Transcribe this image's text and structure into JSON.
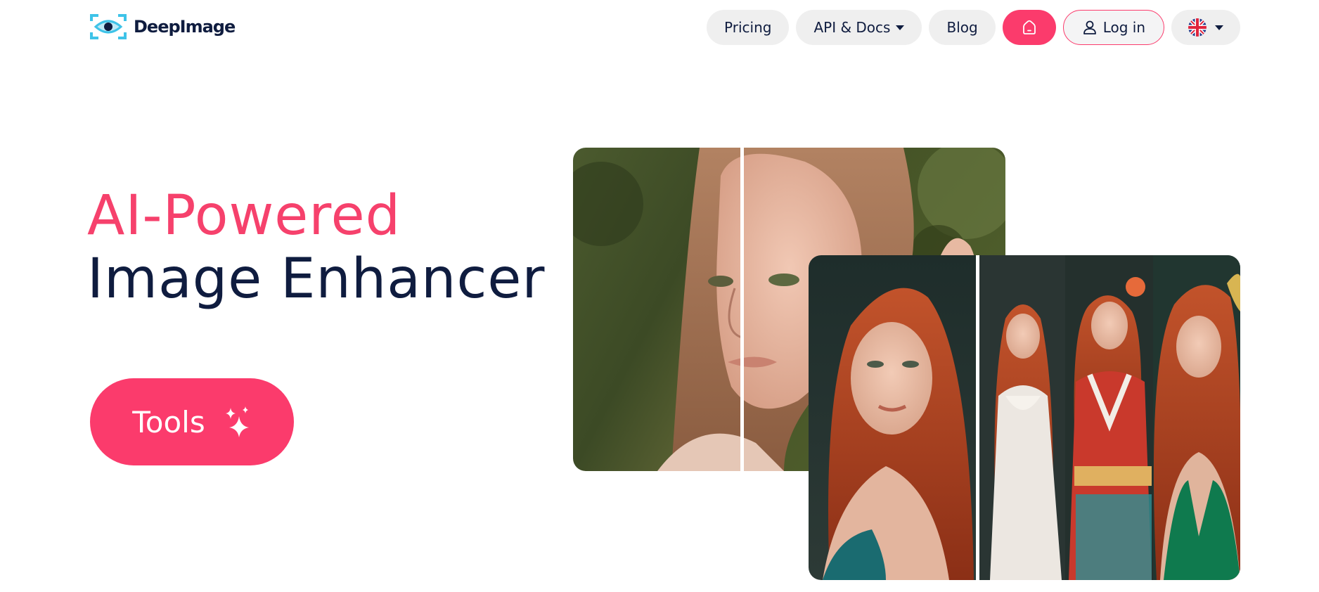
{
  "brand": {
    "name": "DeepImage",
    "accent_color": "#fb3b6c",
    "logo_color": "#3ec3e8",
    "text_color": "#0f1c3f"
  },
  "nav": {
    "pricing_label": "Pricing",
    "api_docs_label": "API & Docs",
    "blog_label": "Blog",
    "home_icon": "home-icon",
    "login_label": "Log in",
    "login_icon": "user-icon",
    "language_icon": "uk-flag-icon"
  },
  "hero": {
    "title_line1": "AI-Powered",
    "title_line2": "Image Enhancer",
    "tools_label": "Tools",
    "tools_icon": "sparkle-icon"
  },
  "images": {
    "back_image": "before-after portrait comparison",
    "front_image": "portrait style variations"
  }
}
